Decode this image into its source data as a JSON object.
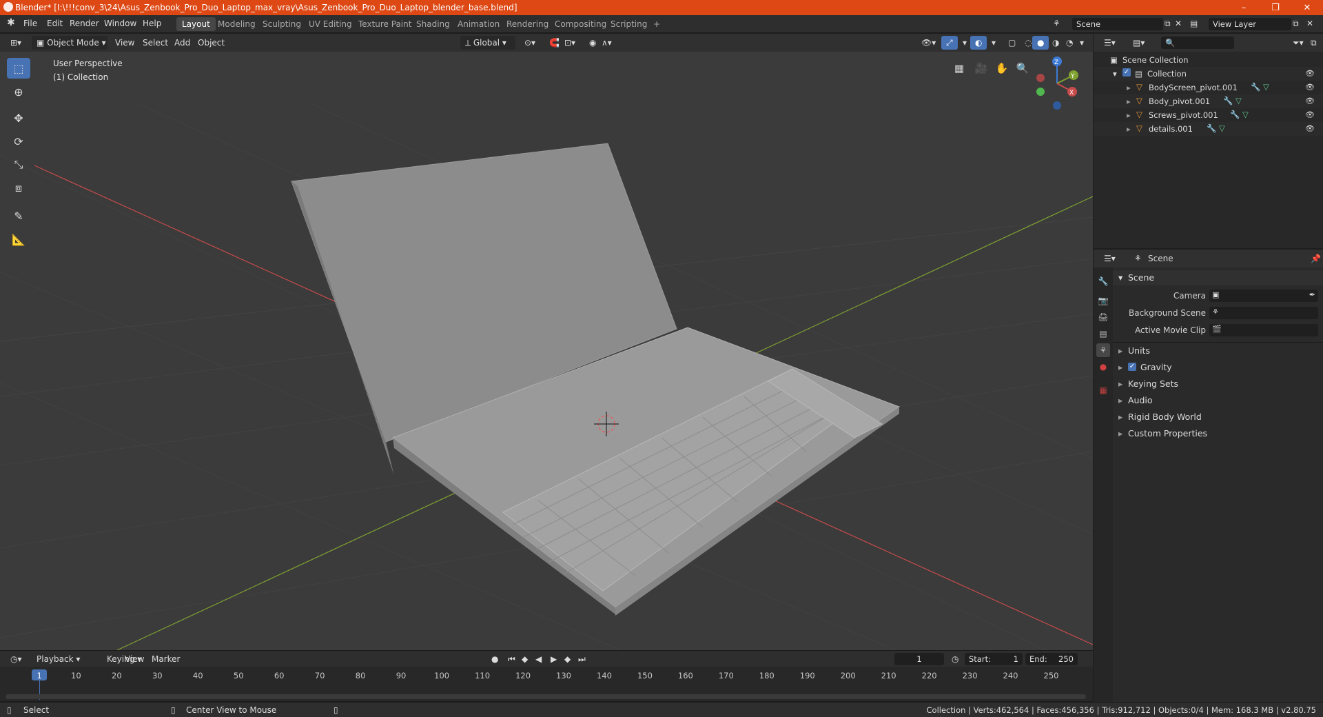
{
  "titlebar": {
    "title": "Blender* [I:\\!!!conv_3\\24\\Asus_Zenbook_Pro_Duo_Laptop_max_vray\\Asus_Zenbook_Pro_Duo_Laptop_blender_base.blend]",
    "minimize": "–",
    "maximize": "❐",
    "close": "✕"
  },
  "menu": {
    "items": [
      "File",
      "Edit",
      "Render",
      "Window",
      "Help"
    ]
  },
  "workspaces": [
    "Layout",
    "Modeling",
    "Sculpting",
    "UV Editing",
    "Texture Paint",
    "Shading",
    "Animation",
    "Rendering",
    "Compositing",
    "Scripting",
    "+"
  ],
  "scene_selector": "Scene",
  "view_layer": "View Layer",
  "viewport_header": {
    "mode": "Object Mode",
    "view": "View",
    "select": "Select",
    "add": "Add",
    "object": "Object",
    "transform_orientation": "Global"
  },
  "viewport": {
    "perspective": "User Perspective",
    "collection": "(1) Collection",
    "gizmo_x": "X",
    "gizmo_y": "Y",
    "gizmo_z": "Z"
  },
  "outliner": {
    "root": "Scene Collection",
    "collection": "Collection",
    "objects": [
      "BodyScreen_pivot.001",
      "Body_pivot.001",
      "Screws_pivot.001",
      "details.001"
    ]
  },
  "properties": {
    "header_title": "Scene",
    "panel_title": "Scene",
    "camera_label": "Camera",
    "background_scene_label": "Background Scene",
    "active_movie_clip_label": "Active Movie Clip",
    "sections": [
      "Units",
      "Gravity",
      "Keying Sets",
      "Audio",
      "Rigid Body World",
      "Custom Properties"
    ]
  },
  "timeline": {
    "playback": "Playback",
    "keying": "Keying",
    "view": "View",
    "marker": "Marker",
    "current_frame": "1",
    "start_label": "Start:",
    "start": "1",
    "end_label": "End:",
    "end": "250",
    "ticks": [
      "1",
      "10",
      "20",
      "30",
      "40",
      "50",
      "60",
      "70",
      "80",
      "90",
      "100",
      "110",
      "120",
      "130",
      "140",
      "150",
      "160",
      "170",
      "180",
      "190",
      "200",
      "210",
      "220",
      "230",
      "240",
      "250"
    ]
  },
  "status": {
    "select": "Select",
    "center_view": "Center View to Mouse",
    "stats": "Collection | Verts:462,564 | Faces:456,356 | Tris:912,712 | Objects:0/4 | Mem: 168.3 MB | v2.80.75"
  },
  "colors": {
    "title_bar": "#dd4814",
    "accent": "#4772b3",
    "viewport_bg": "#3b3b3b",
    "axis_x": "#c84b4b",
    "axis_y": "#7fa231",
    "axis_z": "#3e7bd6"
  }
}
